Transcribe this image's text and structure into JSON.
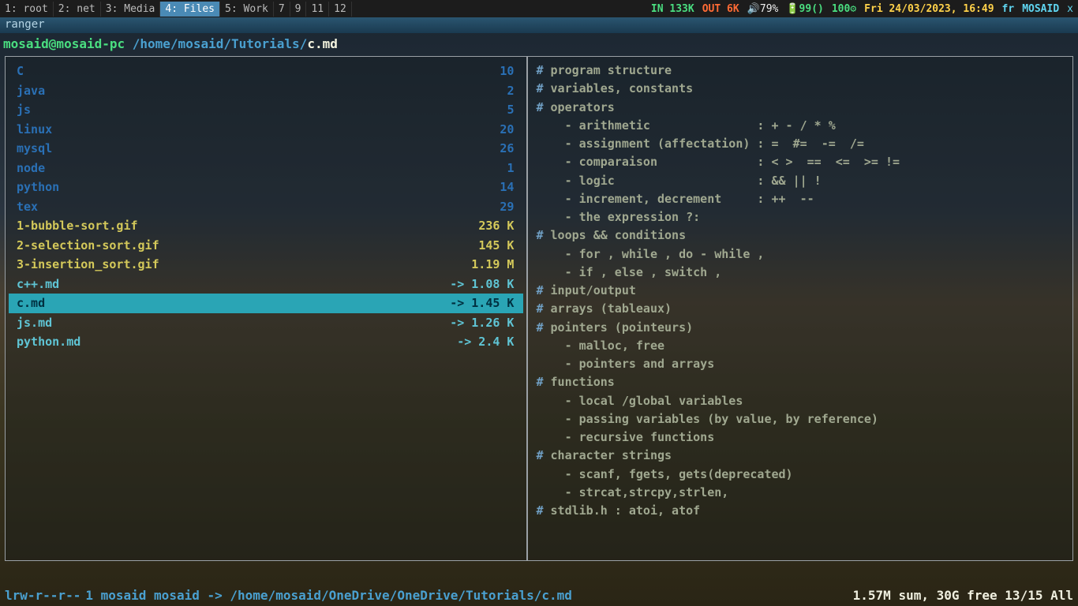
{
  "topbar": {
    "workspaces": [
      {
        "label": "1: root"
      },
      {
        "label": "2: net"
      },
      {
        "label": "3: Media"
      },
      {
        "label": "4: Files",
        "active": true
      },
      {
        "label": "5: Work"
      },
      {
        "label": "7"
      },
      {
        "label": "9"
      },
      {
        "label": "11"
      },
      {
        "label": "12"
      }
    ],
    "net_in": "IN 133K",
    "net_out": "OUT 6K",
    "volume": "🔊79%",
    "battery": "🔋99()",
    "cpu": "100⚙",
    "datetime": "Fri 24/03/2023, 16:49",
    "lang": "fr",
    "user": "MOSAID",
    "close": "x"
  },
  "window_title": "ranger",
  "path": {
    "user": "mosaid@mosaid-pc",
    "dir": " /home/mosaid/Tutorials/",
    "file": "c.md"
  },
  "files": [
    {
      "name": "C",
      "size": "10",
      "kind": "dir"
    },
    {
      "name": "java",
      "size": "2",
      "kind": "dir"
    },
    {
      "name": "js",
      "size": "5",
      "kind": "dir"
    },
    {
      "name": "linux",
      "size": "20",
      "kind": "dir"
    },
    {
      "name": "mysql",
      "size": "26",
      "kind": "dir"
    },
    {
      "name": "node",
      "size": "1",
      "kind": "dir"
    },
    {
      "name": "python",
      "size": "14",
      "kind": "dir"
    },
    {
      "name": "tex",
      "size": "29",
      "kind": "dir"
    },
    {
      "name": "1-bubble-sort.gif",
      "size": "236 K",
      "kind": "file-gif"
    },
    {
      "name": "2-selection-sort.gif",
      "size": "145 K",
      "kind": "file-gif"
    },
    {
      "name": "3-insertion_sort.gif",
      "size": "1.19 M",
      "kind": "file-gif"
    },
    {
      "name": "c++.md",
      "size": "-> 1.08 K",
      "kind": "file-md"
    },
    {
      "name": "c.md",
      "size": "-> 1.45 K",
      "kind": "file-md",
      "selected": true
    },
    {
      "name": "js.md",
      "size": "-> 1.26 K",
      "kind": "file-md"
    },
    {
      "name": "python.md",
      "size": "-> 2.4 K",
      "kind": "file-md"
    }
  ],
  "preview": [
    "# program structure",
    "# variables, constants",
    "# operators",
    "    - arithmetic               : + - / * %",
    "    - assignment (affectation) : =  #=  -=  /=",
    "    - comparaison              : < >  ==  <=  >= !=",
    "    - logic                    : && || !",
    "    - increment, decrement     : ++  --",
    "    - the expression ?:",
    "# loops && conditions",
    "    - for , while , do - while ,",
    "    - if , else , switch ,",
    "# input/output",
    "# arrays (tableaux)",
    "# pointers (pointeurs)",
    "    - malloc, free",
    "    - pointers and arrays",
    "# functions",
    "    - local /global variables",
    "    - passing variables (by value, by reference)",
    "    - recursive functions",
    "# character strings",
    "    - scanf, fgets, gets(deprecated)",
    "    - strcat,strcpy,strlen,",
    "# stdlib.h : atoi, atof"
  ],
  "status": {
    "perms": "lrw-r--r--",
    "links": "1",
    "owner": "mosaid",
    "group": "mosaid",
    "arrow": "->",
    "target": "/home/mosaid/OneDrive/OneDrive/Tutorials/c.md",
    "summary": "1.57M sum, 30G free  13/15  All"
  }
}
